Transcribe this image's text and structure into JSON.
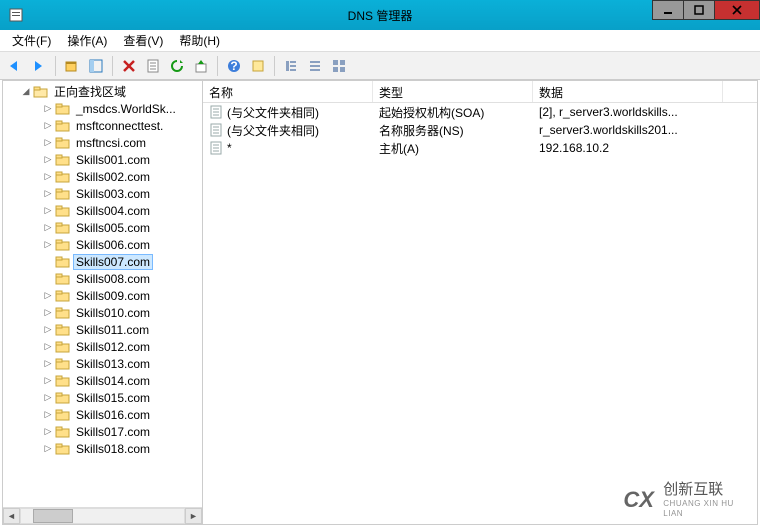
{
  "title": "DNS 管理器",
  "menu": {
    "file": "文件(F)",
    "action": "操作(A)",
    "view": "查看(V)",
    "help": "帮助(H)"
  },
  "tree": {
    "root": "正向查找区域",
    "children": [
      "_msdcs.WorldSk...",
      "msftconnecttest.",
      "msftncsi.com",
      "Skills001.com",
      "Skills002.com",
      "Skills003.com",
      "Skills004.com",
      "Skills005.com",
      "Skills006.com",
      "Skills007.com",
      "Skills008.com",
      "Skills009.com",
      "Skills010.com",
      "Skills011.com",
      "Skills012.com",
      "Skills013.com",
      "Skills014.com",
      "Skills015.com",
      "Skills016.com",
      "Skills017.com",
      "Skills018.com"
    ],
    "selected_index": 9
  },
  "columns": {
    "name": {
      "label": "名称",
      "width": 170
    },
    "type": {
      "label": "类型",
      "width": 160
    },
    "data": {
      "label": "数据",
      "width": 190
    }
  },
  "records": [
    {
      "name": "(与父文件夹相同)",
      "type": "起始授权机构(SOA)",
      "data": "[2], r_server3.worldskills..."
    },
    {
      "name": "(与父文件夹相同)",
      "type": "名称服务器(NS)",
      "data": "r_server3.worldskills201..."
    },
    {
      "name": "*",
      "type": "主机(A)",
      "data": "192.168.10.2"
    }
  ],
  "watermark": {
    "cn": "创新互联",
    "en": "CHUANG XIN HU LIAN"
  }
}
